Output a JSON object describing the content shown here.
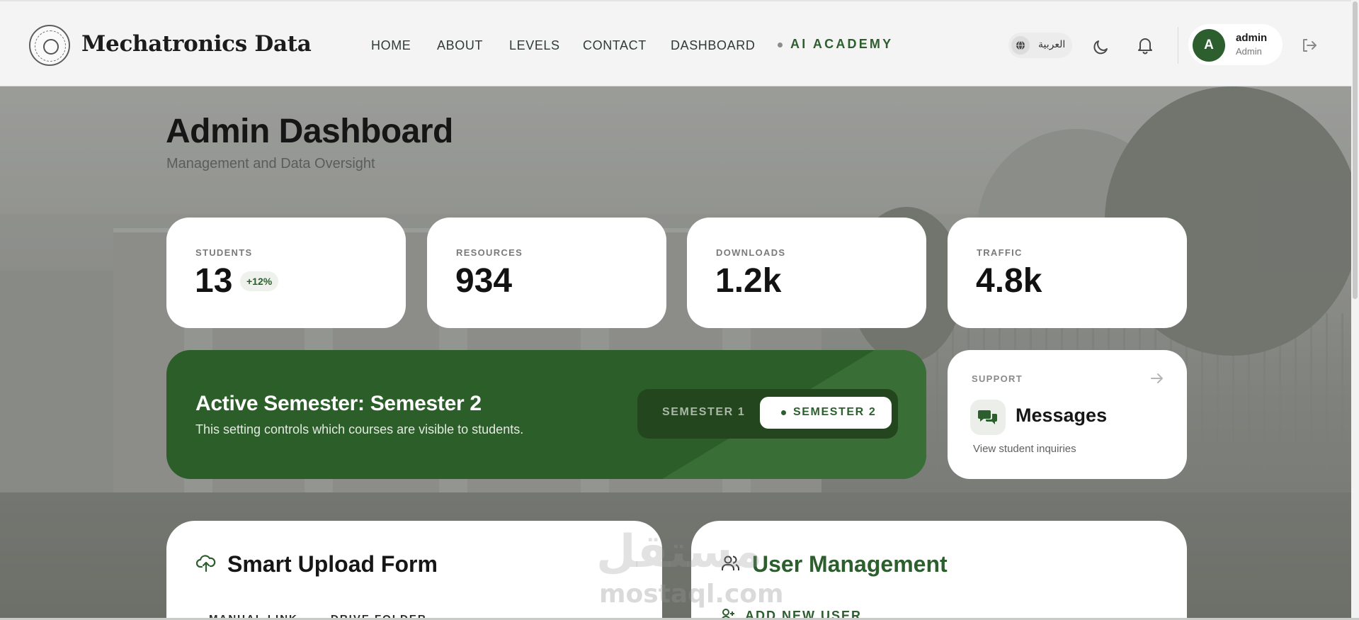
{
  "header": {
    "brand": "Mechatronics Data",
    "nav": {
      "home": "HOME",
      "about": "ABOUT",
      "levels": "LEVELS",
      "contact": "CONTACT",
      "dashboard": "DASHBOARD",
      "ai_academy": "AI ACADEMY"
    },
    "language_label": "العربية",
    "user": {
      "initial": "A",
      "name": "admin",
      "role": "Admin"
    }
  },
  "page": {
    "title": "Admin Dashboard",
    "subtitle": "Management and Data Oversight"
  },
  "stats": [
    {
      "label": "STUDENTS",
      "value": "13",
      "badge": "+12%"
    },
    {
      "label": "RESOURCES",
      "value": "934"
    },
    {
      "label": "DOWNLOADS",
      "value": "1.2k"
    },
    {
      "label": "TRAFFIC",
      "value": "4.8k"
    }
  ],
  "semester": {
    "title": "Active Semester: Semester 2",
    "description": "This setting controls which courses are visible to students.",
    "option_1": "SEMESTER 1",
    "option_2": "SEMESTER 2",
    "selected": "SEMESTER 2"
  },
  "support": {
    "label": "SUPPORT",
    "title": "Messages",
    "subtitle": "View student inquiries"
  },
  "upload_panel": {
    "title": "Smart Upload Form",
    "tab_1": "MANUAL LINK",
    "tab_2": "DRIVE FOLDER"
  },
  "user_panel": {
    "title": "User Management",
    "add_label": "ADD NEW USER"
  },
  "watermark": {
    "arabic": "مستقل",
    "latin": "mostaql.com"
  },
  "colors": {
    "brand_green": "#2c5e2e",
    "header_bg": "#f4f4f4",
    "card_bg": "#ffffff"
  }
}
